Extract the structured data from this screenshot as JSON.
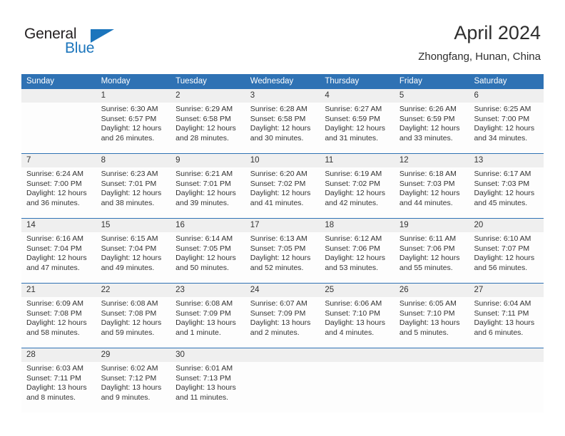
{
  "brand": {
    "name_part1": "General",
    "name_part2": "Blue",
    "logo_icon": "blue-triangle-icon",
    "accent_color": "#1b75bc"
  },
  "header": {
    "title": "April 2024",
    "subtitle": "Zhongfang, Hunan, China"
  },
  "theme": {
    "header_blue": "#2f72b4",
    "date_band_gray": "#efefef",
    "cell_white": "#fdfdfd",
    "text_dark": "#333333"
  },
  "weekdays": [
    "Sunday",
    "Monday",
    "Tuesday",
    "Wednesday",
    "Thursday",
    "Friday",
    "Saturday"
  ],
  "weeks": [
    {
      "days": [
        {
          "date": "",
          "sunrise": "",
          "sunset": "",
          "daylight": "",
          "empty": true
        },
        {
          "date": "1",
          "sunrise": "Sunrise: 6:30 AM",
          "sunset": "Sunset: 6:57 PM",
          "daylight": "Daylight: 12 hours and 26 minutes."
        },
        {
          "date": "2",
          "sunrise": "Sunrise: 6:29 AM",
          "sunset": "Sunset: 6:58 PM",
          "daylight": "Daylight: 12 hours and 28 minutes."
        },
        {
          "date": "3",
          "sunrise": "Sunrise: 6:28 AM",
          "sunset": "Sunset: 6:58 PM",
          "daylight": "Daylight: 12 hours and 30 minutes."
        },
        {
          "date": "4",
          "sunrise": "Sunrise: 6:27 AM",
          "sunset": "Sunset: 6:59 PM",
          "daylight": "Daylight: 12 hours and 31 minutes."
        },
        {
          "date": "5",
          "sunrise": "Sunrise: 6:26 AM",
          "sunset": "Sunset: 6:59 PM",
          "daylight": "Daylight: 12 hours and 33 minutes."
        },
        {
          "date": "6",
          "sunrise": "Sunrise: 6:25 AM",
          "sunset": "Sunset: 7:00 PM",
          "daylight": "Daylight: 12 hours and 34 minutes."
        }
      ]
    },
    {
      "days": [
        {
          "date": "7",
          "sunrise": "Sunrise: 6:24 AM",
          "sunset": "Sunset: 7:00 PM",
          "daylight": "Daylight: 12 hours and 36 minutes."
        },
        {
          "date": "8",
          "sunrise": "Sunrise: 6:23 AM",
          "sunset": "Sunset: 7:01 PM",
          "daylight": "Daylight: 12 hours and 38 minutes."
        },
        {
          "date": "9",
          "sunrise": "Sunrise: 6:21 AM",
          "sunset": "Sunset: 7:01 PM",
          "daylight": "Daylight: 12 hours and 39 minutes."
        },
        {
          "date": "10",
          "sunrise": "Sunrise: 6:20 AM",
          "sunset": "Sunset: 7:02 PM",
          "daylight": "Daylight: 12 hours and 41 minutes."
        },
        {
          "date": "11",
          "sunrise": "Sunrise: 6:19 AM",
          "sunset": "Sunset: 7:02 PM",
          "daylight": "Daylight: 12 hours and 42 minutes."
        },
        {
          "date": "12",
          "sunrise": "Sunrise: 6:18 AM",
          "sunset": "Sunset: 7:03 PM",
          "daylight": "Daylight: 12 hours and 44 minutes."
        },
        {
          "date": "13",
          "sunrise": "Sunrise: 6:17 AM",
          "sunset": "Sunset: 7:03 PM",
          "daylight": "Daylight: 12 hours and 45 minutes."
        }
      ]
    },
    {
      "days": [
        {
          "date": "14",
          "sunrise": "Sunrise: 6:16 AM",
          "sunset": "Sunset: 7:04 PM",
          "daylight": "Daylight: 12 hours and 47 minutes."
        },
        {
          "date": "15",
          "sunrise": "Sunrise: 6:15 AM",
          "sunset": "Sunset: 7:04 PM",
          "daylight": "Daylight: 12 hours and 49 minutes."
        },
        {
          "date": "16",
          "sunrise": "Sunrise: 6:14 AM",
          "sunset": "Sunset: 7:05 PM",
          "daylight": "Daylight: 12 hours and 50 minutes."
        },
        {
          "date": "17",
          "sunrise": "Sunrise: 6:13 AM",
          "sunset": "Sunset: 7:05 PM",
          "daylight": "Daylight: 12 hours and 52 minutes."
        },
        {
          "date": "18",
          "sunrise": "Sunrise: 6:12 AM",
          "sunset": "Sunset: 7:06 PM",
          "daylight": "Daylight: 12 hours and 53 minutes."
        },
        {
          "date": "19",
          "sunrise": "Sunrise: 6:11 AM",
          "sunset": "Sunset: 7:06 PM",
          "daylight": "Daylight: 12 hours and 55 minutes."
        },
        {
          "date": "20",
          "sunrise": "Sunrise: 6:10 AM",
          "sunset": "Sunset: 7:07 PM",
          "daylight": "Daylight: 12 hours and 56 minutes."
        }
      ]
    },
    {
      "days": [
        {
          "date": "21",
          "sunrise": "Sunrise: 6:09 AM",
          "sunset": "Sunset: 7:08 PM",
          "daylight": "Daylight: 12 hours and 58 minutes."
        },
        {
          "date": "22",
          "sunrise": "Sunrise: 6:08 AM",
          "sunset": "Sunset: 7:08 PM",
          "daylight": "Daylight: 12 hours and 59 minutes."
        },
        {
          "date": "23",
          "sunrise": "Sunrise: 6:08 AM",
          "sunset": "Sunset: 7:09 PM",
          "daylight": "Daylight: 13 hours and 1 minute."
        },
        {
          "date": "24",
          "sunrise": "Sunrise: 6:07 AM",
          "sunset": "Sunset: 7:09 PM",
          "daylight": "Daylight: 13 hours and 2 minutes."
        },
        {
          "date": "25",
          "sunrise": "Sunrise: 6:06 AM",
          "sunset": "Sunset: 7:10 PM",
          "daylight": "Daylight: 13 hours and 4 minutes."
        },
        {
          "date": "26",
          "sunrise": "Sunrise: 6:05 AM",
          "sunset": "Sunset: 7:10 PM",
          "daylight": "Daylight: 13 hours and 5 minutes."
        },
        {
          "date": "27",
          "sunrise": "Sunrise: 6:04 AM",
          "sunset": "Sunset: 7:11 PM",
          "daylight": "Daylight: 13 hours and 6 minutes."
        }
      ]
    },
    {
      "days": [
        {
          "date": "28",
          "sunrise": "Sunrise: 6:03 AM",
          "sunset": "Sunset: 7:11 PM",
          "daylight": "Daylight: 13 hours and 8 minutes."
        },
        {
          "date": "29",
          "sunrise": "Sunrise: 6:02 AM",
          "sunset": "Sunset: 7:12 PM",
          "daylight": "Daylight: 13 hours and 9 minutes."
        },
        {
          "date": "30",
          "sunrise": "Sunrise: 6:01 AM",
          "sunset": "Sunset: 7:13 PM",
          "daylight": "Daylight: 13 hours and 11 minutes."
        },
        {
          "date": "",
          "sunrise": "",
          "sunset": "",
          "daylight": "",
          "empty": true
        },
        {
          "date": "",
          "sunrise": "",
          "sunset": "",
          "daylight": "",
          "empty": true
        },
        {
          "date": "",
          "sunrise": "",
          "sunset": "",
          "daylight": "",
          "empty": true
        },
        {
          "date": "",
          "sunrise": "",
          "sunset": "",
          "daylight": "",
          "empty": true
        }
      ]
    }
  ]
}
